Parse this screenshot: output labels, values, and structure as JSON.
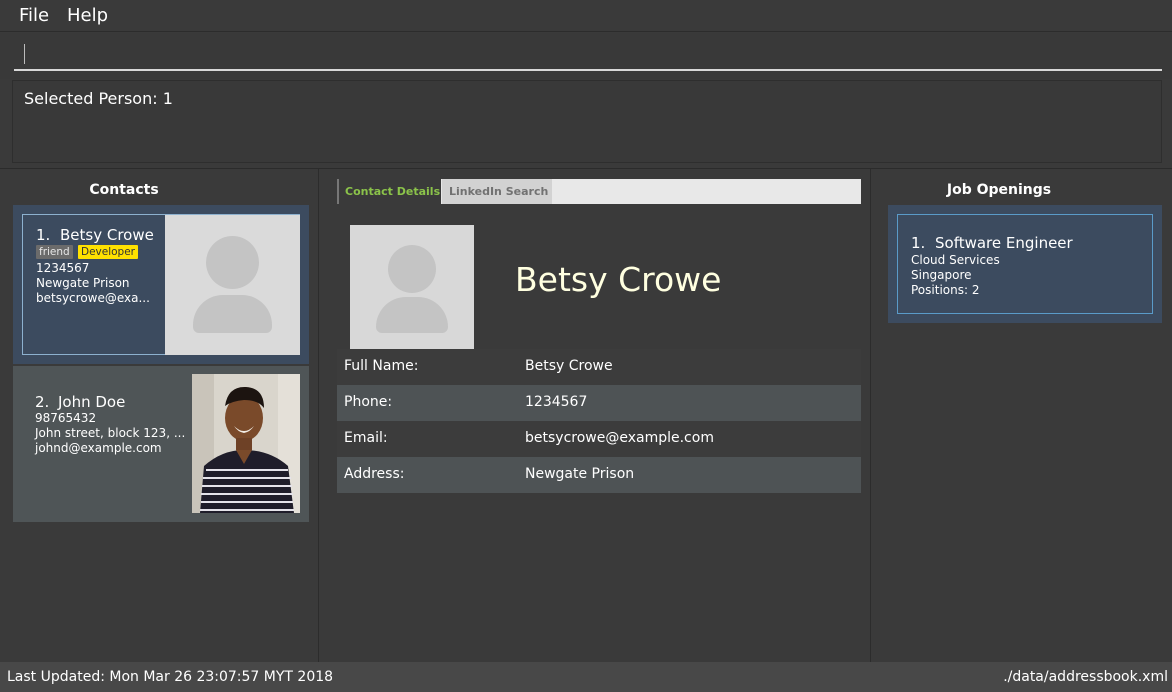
{
  "menu": {
    "file": "File",
    "help": "Help"
  },
  "command_box": {
    "value": ""
  },
  "result_display": {
    "text": "Selected Person: 1"
  },
  "contacts_panel": {
    "title": "Contacts",
    "cards": [
      {
        "index": "1.",
        "name": "Betsy Crowe",
        "tags": [
          "friend",
          "Developer"
        ],
        "phone": "1234567",
        "address": "Newgate Prison",
        "email": "betsycrowe@exa..."
      },
      {
        "index": "2.",
        "name": "John Doe",
        "phone": "98765432",
        "address": "John street, block 123, ...",
        "email": "johnd@example.com"
      }
    ]
  },
  "detail_panel": {
    "tabs": {
      "active": "Contact Details",
      "other": "LinkedIn Search"
    },
    "name": "Betsy Crowe",
    "fields": [
      {
        "label": "Full Name:",
        "value": "Betsy Crowe"
      },
      {
        "label": "Phone:",
        "value": "1234567"
      },
      {
        "label": "Email:",
        "value": "betsycrowe@example.com"
      },
      {
        "label": "Address:",
        "value": "Newgate Prison"
      }
    ]
  },
  "jobs_panel": {
    "title": "Job Openings",
    "jobs": [
      {
        "index": "1.",
        "title": "Software Engineer",
        "team": "Cloud Services",
        "location": "Singapore",
        "positions": "Positions: 2"
      }
    ]
  },
  "status_bar": {
    "last_updated": "Last Updated: Mon Mar 26 23:07:57 MYT 2018",
    "file_path": "./data/addressbook.xml"
  },
  "colors": {
    "background": "#3a3a3a",
    "selected_card": "#3c4b5f",
    "tag_developer": "#ffe100",
    "active_tab_text": "#8bc34a",
    "title_name": "#ffffe0"
  }
}
